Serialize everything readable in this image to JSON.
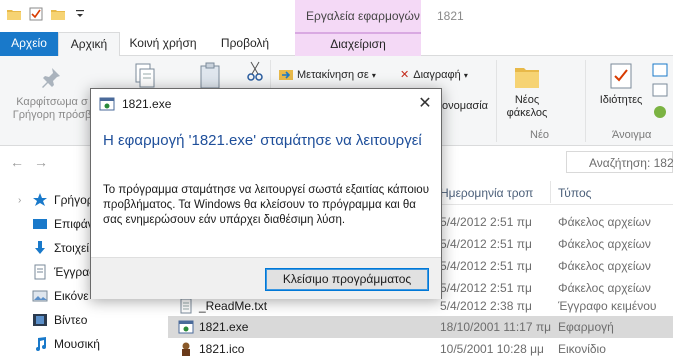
{
  "window": {
    "title": "1821"
  },
  "tools_header": "Εργαλεία εφαρμογών",
  "tabs": {
    "file": "Αρχείο",
    "home": "Αρχική",
    "share": "Κοινή χρήση",
    "view": "Προβολή",
    "manage": "Διαχείριση"
  },
  "ribbon": {
    "pin_label": "Καρφίτσωμα σ",
    "pin_label2": "Γρήγορη πρόσβ",
    "move_to": "Μετακίνηση σε",
    "delete": "Διαγραφή",
    "rename": "ονομασία",
    "new_folder_1": "Νέος",
    "new_folder_2": "φάκελος",
    "new_group": "Νέο",
    "properties": "Ιδιότητες",
    "open_group": "Άνοιγμα"
  },
  "search": {
    "placeholder": "Αναζήτηση: 1821"
  },
  "nav": {
    "items": [
      {
        "label": "Γρήγορ",
        "icon": "star-icon"
      },
      {
        "label": "Επιφάν",
        "icon": "desktop-icon"
      },
      {
        "label": "Στοιχεί",
        "icon": "downloads-icon"
      },
      {
        "label": "Έγγραφ",
        "icon": "documents-icon"
      },
      {
        "label": "Εικόνε",
        "icon": "pictures-icon"
      },
      {
        "label": "Βίντεο",
        "icon": "videos-icon"
      },
      {
        "label": "Μουσική",
        "icon": "music-icon"
      }
    ]
  },
  "columns": {
    "date": "Ημερομηνία τροπ",
    "type": "Τύπος"
  },
  "files": [
    {
      "name": "",
      "date": "5/4/2012 2:51 πμ",
      "type": "Φάκελος αρχείων",
      "icon": "folder-icon"
    },
    {
      "name": "",
      "date": "5/4/2012 2:51 πμ",
      "type": "Φάκελος αρχείων",
      "icon": "folder-icon"
    },
    {
      "name": "",
      "date": "5/4/2012 2:51 πμ",
      "type": "Φάκελος αρχείων",
      "icon": "folder-icon"
    },
    {
      "name": "",
      "date": "5/4/2012 2:51 πμ",
      "type": "Φάκελος αρχείων",
      "icon": "folder-icon"
    },
    {
      "name": "_ReadMe.txt",
      "date": "5/4/2012 2:38 πμ",
      "type": "Έγγραφο κειμένου",
      "icon": "text-file-icon"
    },
    {
      "name": "1821.exe",
      "date": "18/10/2001 11:17 πμ",
      "type": "Εφαρμογή",
      "icon": "exe-icon",
      "selected": true
    },
    {
      "name": "1821.ico",
      "date": "10/5/2001 10:28 μμ",
      "type": "Εικονίδιο",
      "icon": "ico-file-icon"
    }
  ],
  "dialog": {
    "title": "1821.exe",
    "heading": "Η εφαρμογή '1821.exe' σταμάτησε να λειτουργεί",
    "body": "Το πρόγραμμα σταμάτησε να λειτουργεί σωστά εξαιτίας κάποιου προβλήματος. Τα Windows θα κλείσουν το πρόγραμμα και θα σας ενημερώσουν εάν υπάρχει διαθέσιμη λύση.",
    "button": "Κλείσιμο προγράμματος",
    "close_glyph": "✕"
  }
}
